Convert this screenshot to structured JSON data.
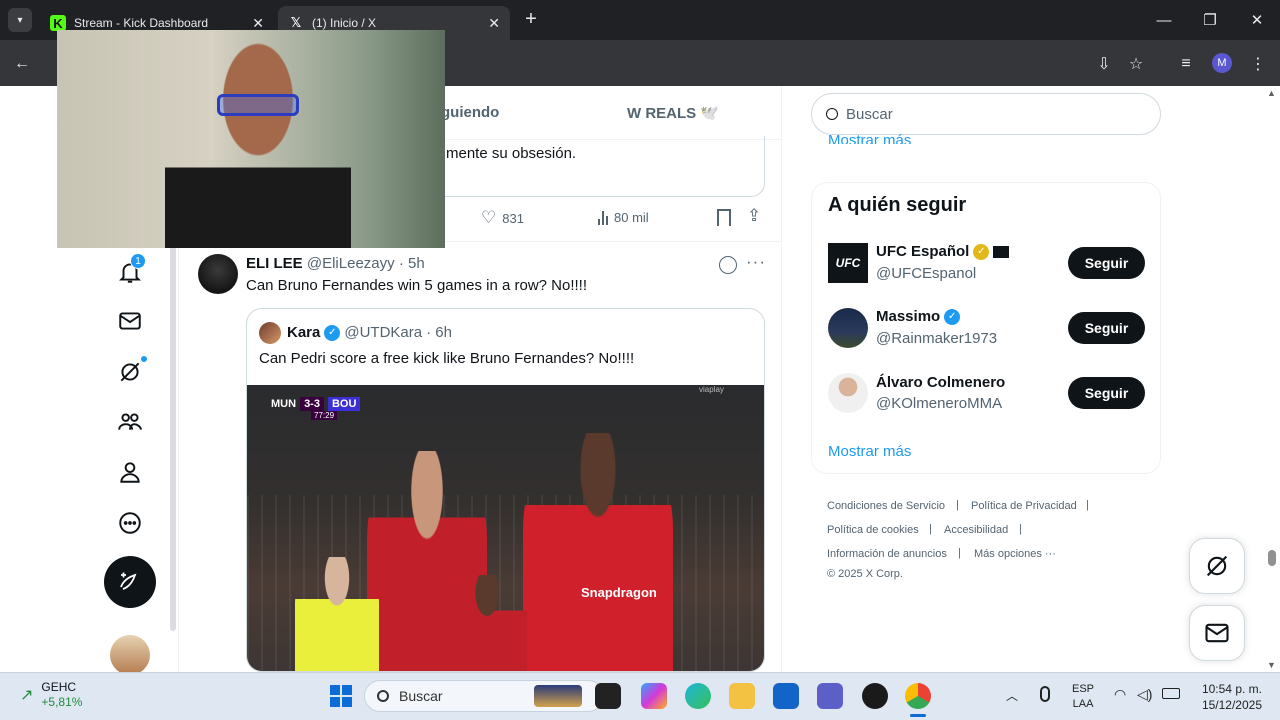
{
  "browser": {
    "tabs": [
      {
        "label": "Stream - Kick Dashboard",
        "active": false
      },
      {
        "label": "(1) Inicio / X",
        "active": true
      }
    ],
    "new_tab_label": "+",
    "profile_initial": "M"
  },
  "top_tabs": {
    "following_partial": "guiendo",
    "wreals": "W REALS 🕊️"
  },
  "prev_tweet": {
    "text_tail": "mente su obsesión.",
    "likes": "831",
    "views": "80 mil"
  },
  "tweet": {
    "name": "ELI LEE",
    "handle": "@EliLeezayy",
    "time": "· 5h",
    "text": "Can Bruno Fernandes win 5 games in a row? No!!!!",
    "quote": {
      "name": "Kara",
      "handle": "@UTDKara",
      "time": "· 6h",
      "text": "Can Pedri score a free kick like Bruno Fernandes? No!!!!",
      "scoreboard": {
        "home": "MUN",
        "score": "3-3",
        "away": "BOU",
        "clock": "77:29"
      },
      "broadcaster": "viaplay",
      "sponsor": "Snapdragon"
    }
  },
  "notifications_badge": "1",
  "sidebar": {
    "search_placeholder": "Buscar",
    "show_more_top": "Mostrar más",
    "who_to_follow_title": "A quién seguir",
    "follow_label": "Seguir",
    "accounts": [
      {
        "name": "UFC Español",
        "handle": "@UFCEspanol",
        "avatar_text": "UFC"
      },
      {
        "name": "Massimo",
        "handle": "@Rainmaker1973"
      },
      {
        "name": "Álvaro Colmenero",
        "handle": "@KOlmeneroMMA"
      }
    ],
    "show_more": "Mostrar más",
    "footer": {
      "terms": "Condiciones de Servicio",
      "privacy": "Política de Privacidad",
      "cookies": "Política de cookies",
      "accessibility": "Accesibilidad",
      "ads": "Información de anuncios",
      "more": "Más opciones ···",
      "copyright": "© 2025 X Corp."
    }
  },
  "taskbar": {
    "stock_name": "GEHC",
    "stock_change": "+5,81%",
    "search": "Buscar",
    "lang_1": "ESP",
    "lang_2": "LAA",
    "time": "10:54 p. m.",
    "date": "15/12/2025"
  },
  "colors": {
    "x_blue": "#1d9bf0",
    "dark": "#0f1419",
    "muted": "#536471",
    "chrome_dark": "#202124",
    "taskbar": "#dfe8f2"
  }
}
